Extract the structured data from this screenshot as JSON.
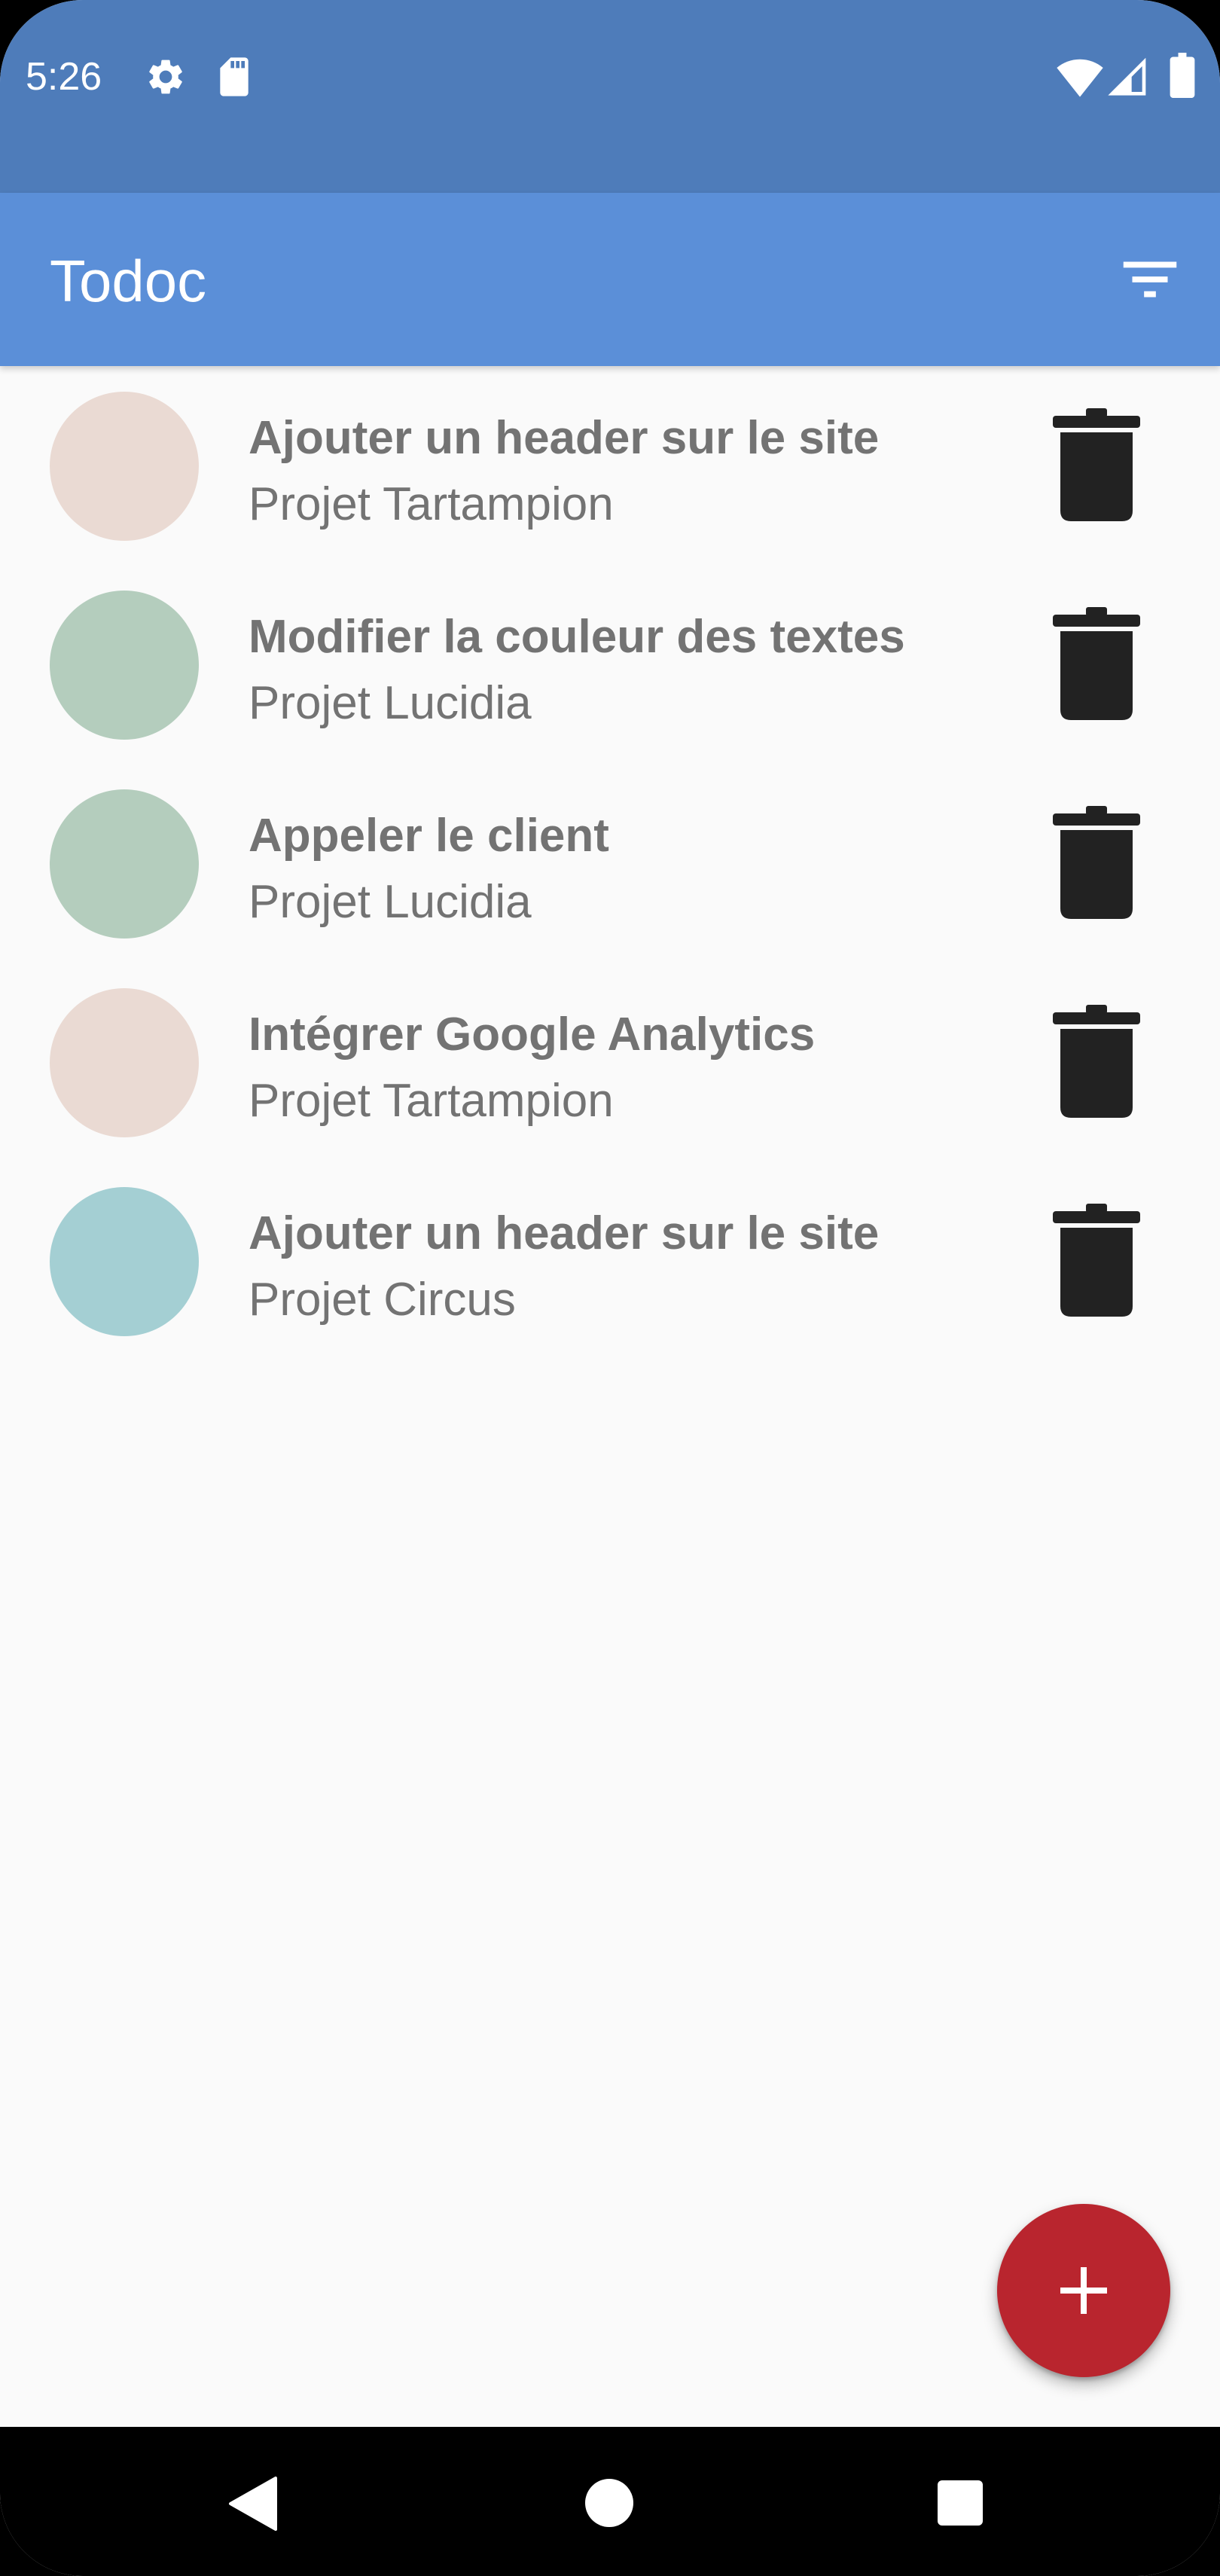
{
  "status_bar": {
    "time": "5:26",
    "left_icons": [
      "gear-icon",
      "sd-card-icon"
    ],
    "right_icons": [
      "wifi-icon",
      "cell-signal-icon",
      "battery-icon"
    ],
    "background": "#4e7cba"
  },
  "app_bar": {
    "title": "Todoc",
    "action_icon": "filter-icon",
    "background": "#5b8fd8"
  },
  "tasks": [
    {
      "name": "Ajouter un header sur le site",
      "project": "Projet Tartampion",
      "color": "#eadad3"
    },
    {
      "name": "Modifier la couleur des textes",
      "project": "Projet Lucidia",
      "color": "#b4cdbd"
    },
    {
      "name": "Appeler le client",
      "project": "Projet Lucidia",
      "color": "#b4cdbd"
    },
    {
      "name": "Intégrer Google Analytics",
      "project": "Projet Tartampion",
      "color": "#eadad3"
    },
    {
      "name": "Ajouter un header sur le site",
      "project": "Projet Circus",
      "color": "#a4cfd3"
    }
  ],
  "fab": {
    "icon": "plus-icon",
    "color": "#b9252e"
  },
  "nav_bar": {
    "icons": [
      "back-icon",
      "home-icon",
      "recents-icon"
    ]
  }
}
